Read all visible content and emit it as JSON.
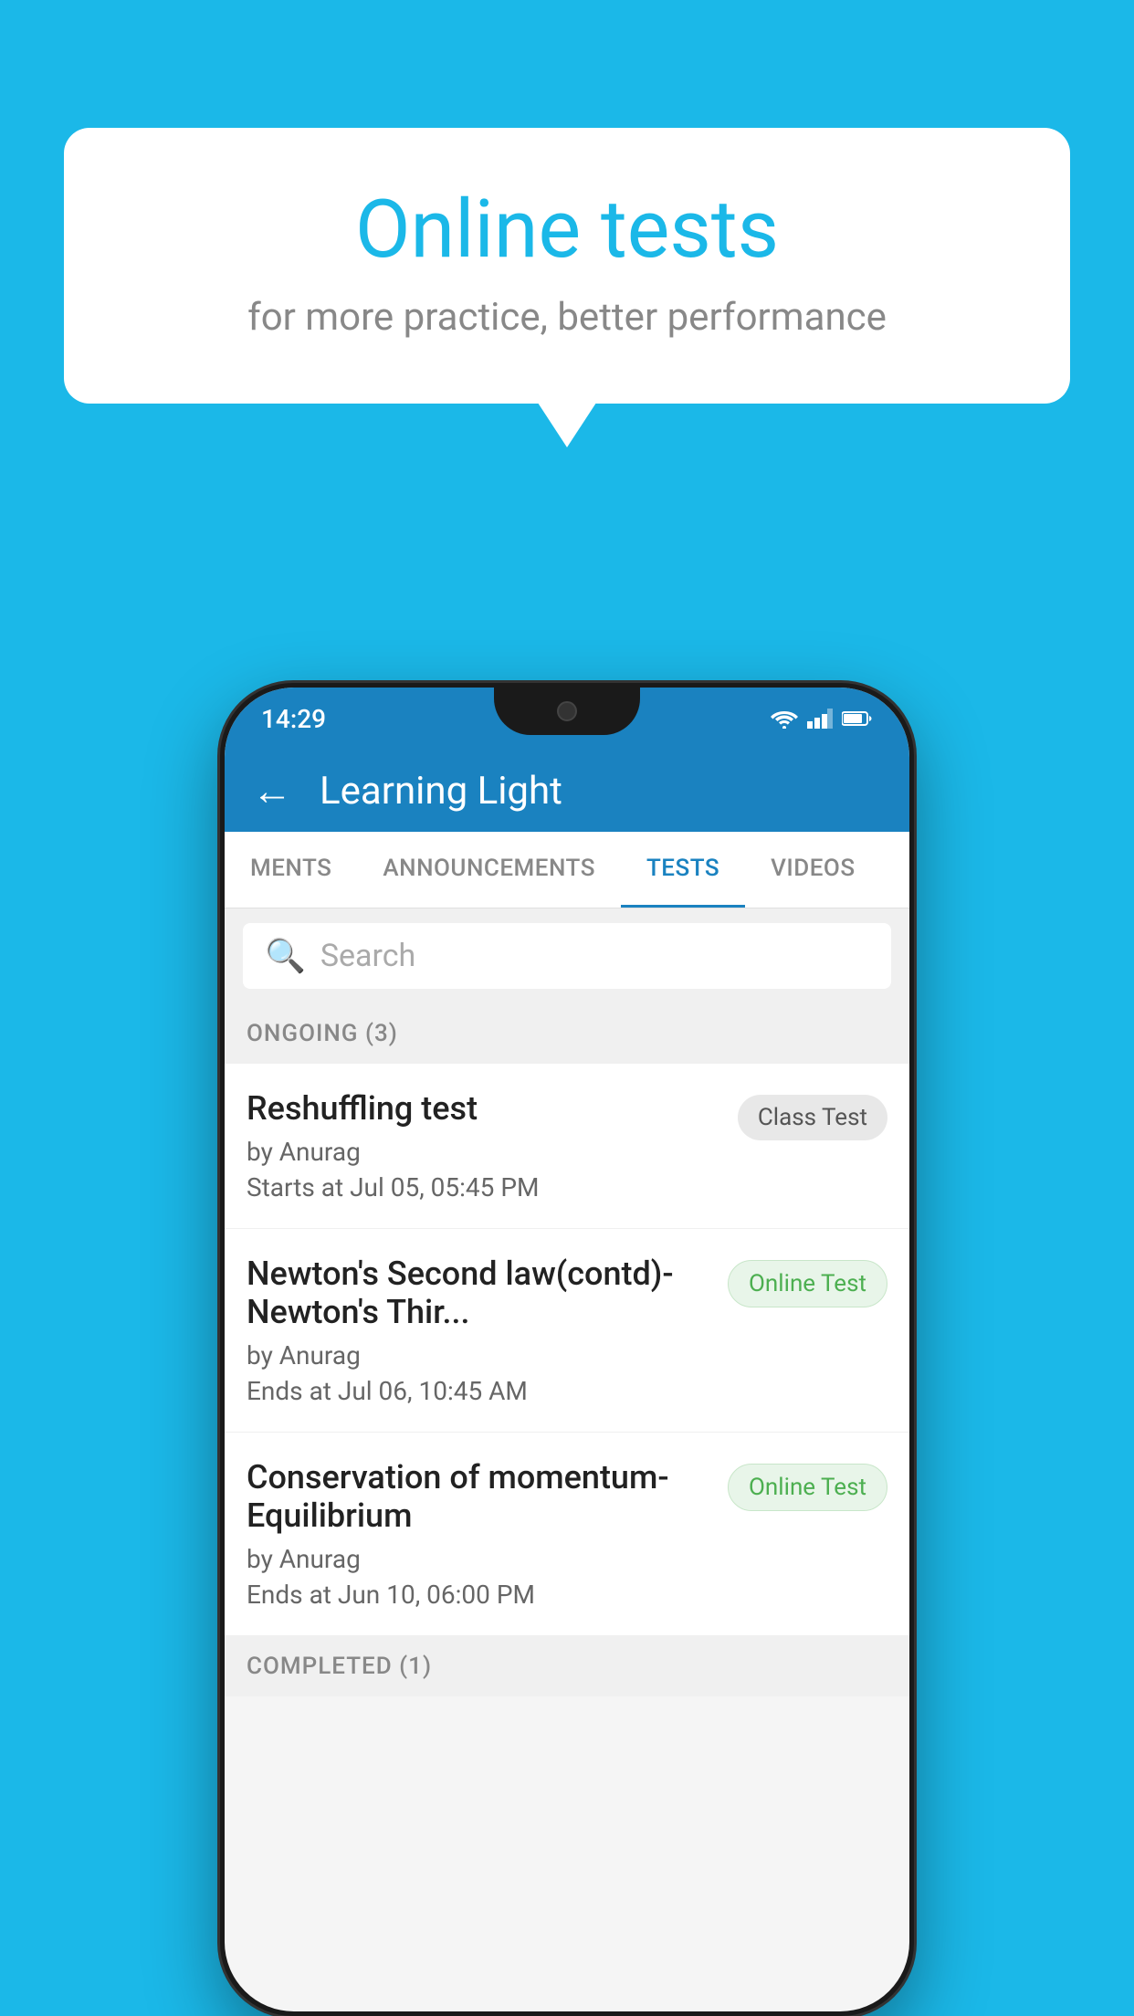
{
  "background_color": "#1bb8e8",
  "bubble": {
    "title": "Online tests",
    "subtitle": "for more practice, better performance"
  },
  "phone": {
    "status_bar": {
      "time": "14:29"
    },
    "app_bar": {
      "title": "Learning Light",
      "back_label": "←"
    },
    "tabs": [
      {
        "id": "ments",
        "label": "MENTS",
        "active": false
      },
      {
        "id": "announcements",
        "label": "ANNOUNCEMENTS",
        "active": false
      },
      {
        "id": "tests",
        "label": "TESTS",
        "active": true
      },
      {
        "id": "videos",
        "label": "VIDEOS",
        "active": false
      }
    ],
    "search": {
      "placeholder": "Search"
    },
    "ongoing_section": {
      "label": "ONGOING (3)"
    },
    "test_items": [
      {
        "name": "Reshuffling test",
        "author": "by Anurag",
        "time_label": "Starts at",
        "time_value": "Jul 05, 05:45 PM",
        "badge": "Class Test",
        "badge_type": "class"
      },
      {
        "name": "Newton's Second law(contd)-Newton's Thir...",
        "author": "by Anurag",
        "time_label": "Ends at",
        "time_value": "Jul 06, 10:45 AM",
        "badge": "Online Test",
        "badge_type": "online"
      },
      {
        "name": "Conservation of momentum-Equilibrium",
        "author": "by Anurag",
        "time_label": "Ends at",
        "time_value": "Jun 10, 06:00 PM",
        "badge": "Online Test",
        "badge_type": "online"
      }
    ],
    "completed_section": {
      "label": "COMPLETED (1)"
    }
  }
}
